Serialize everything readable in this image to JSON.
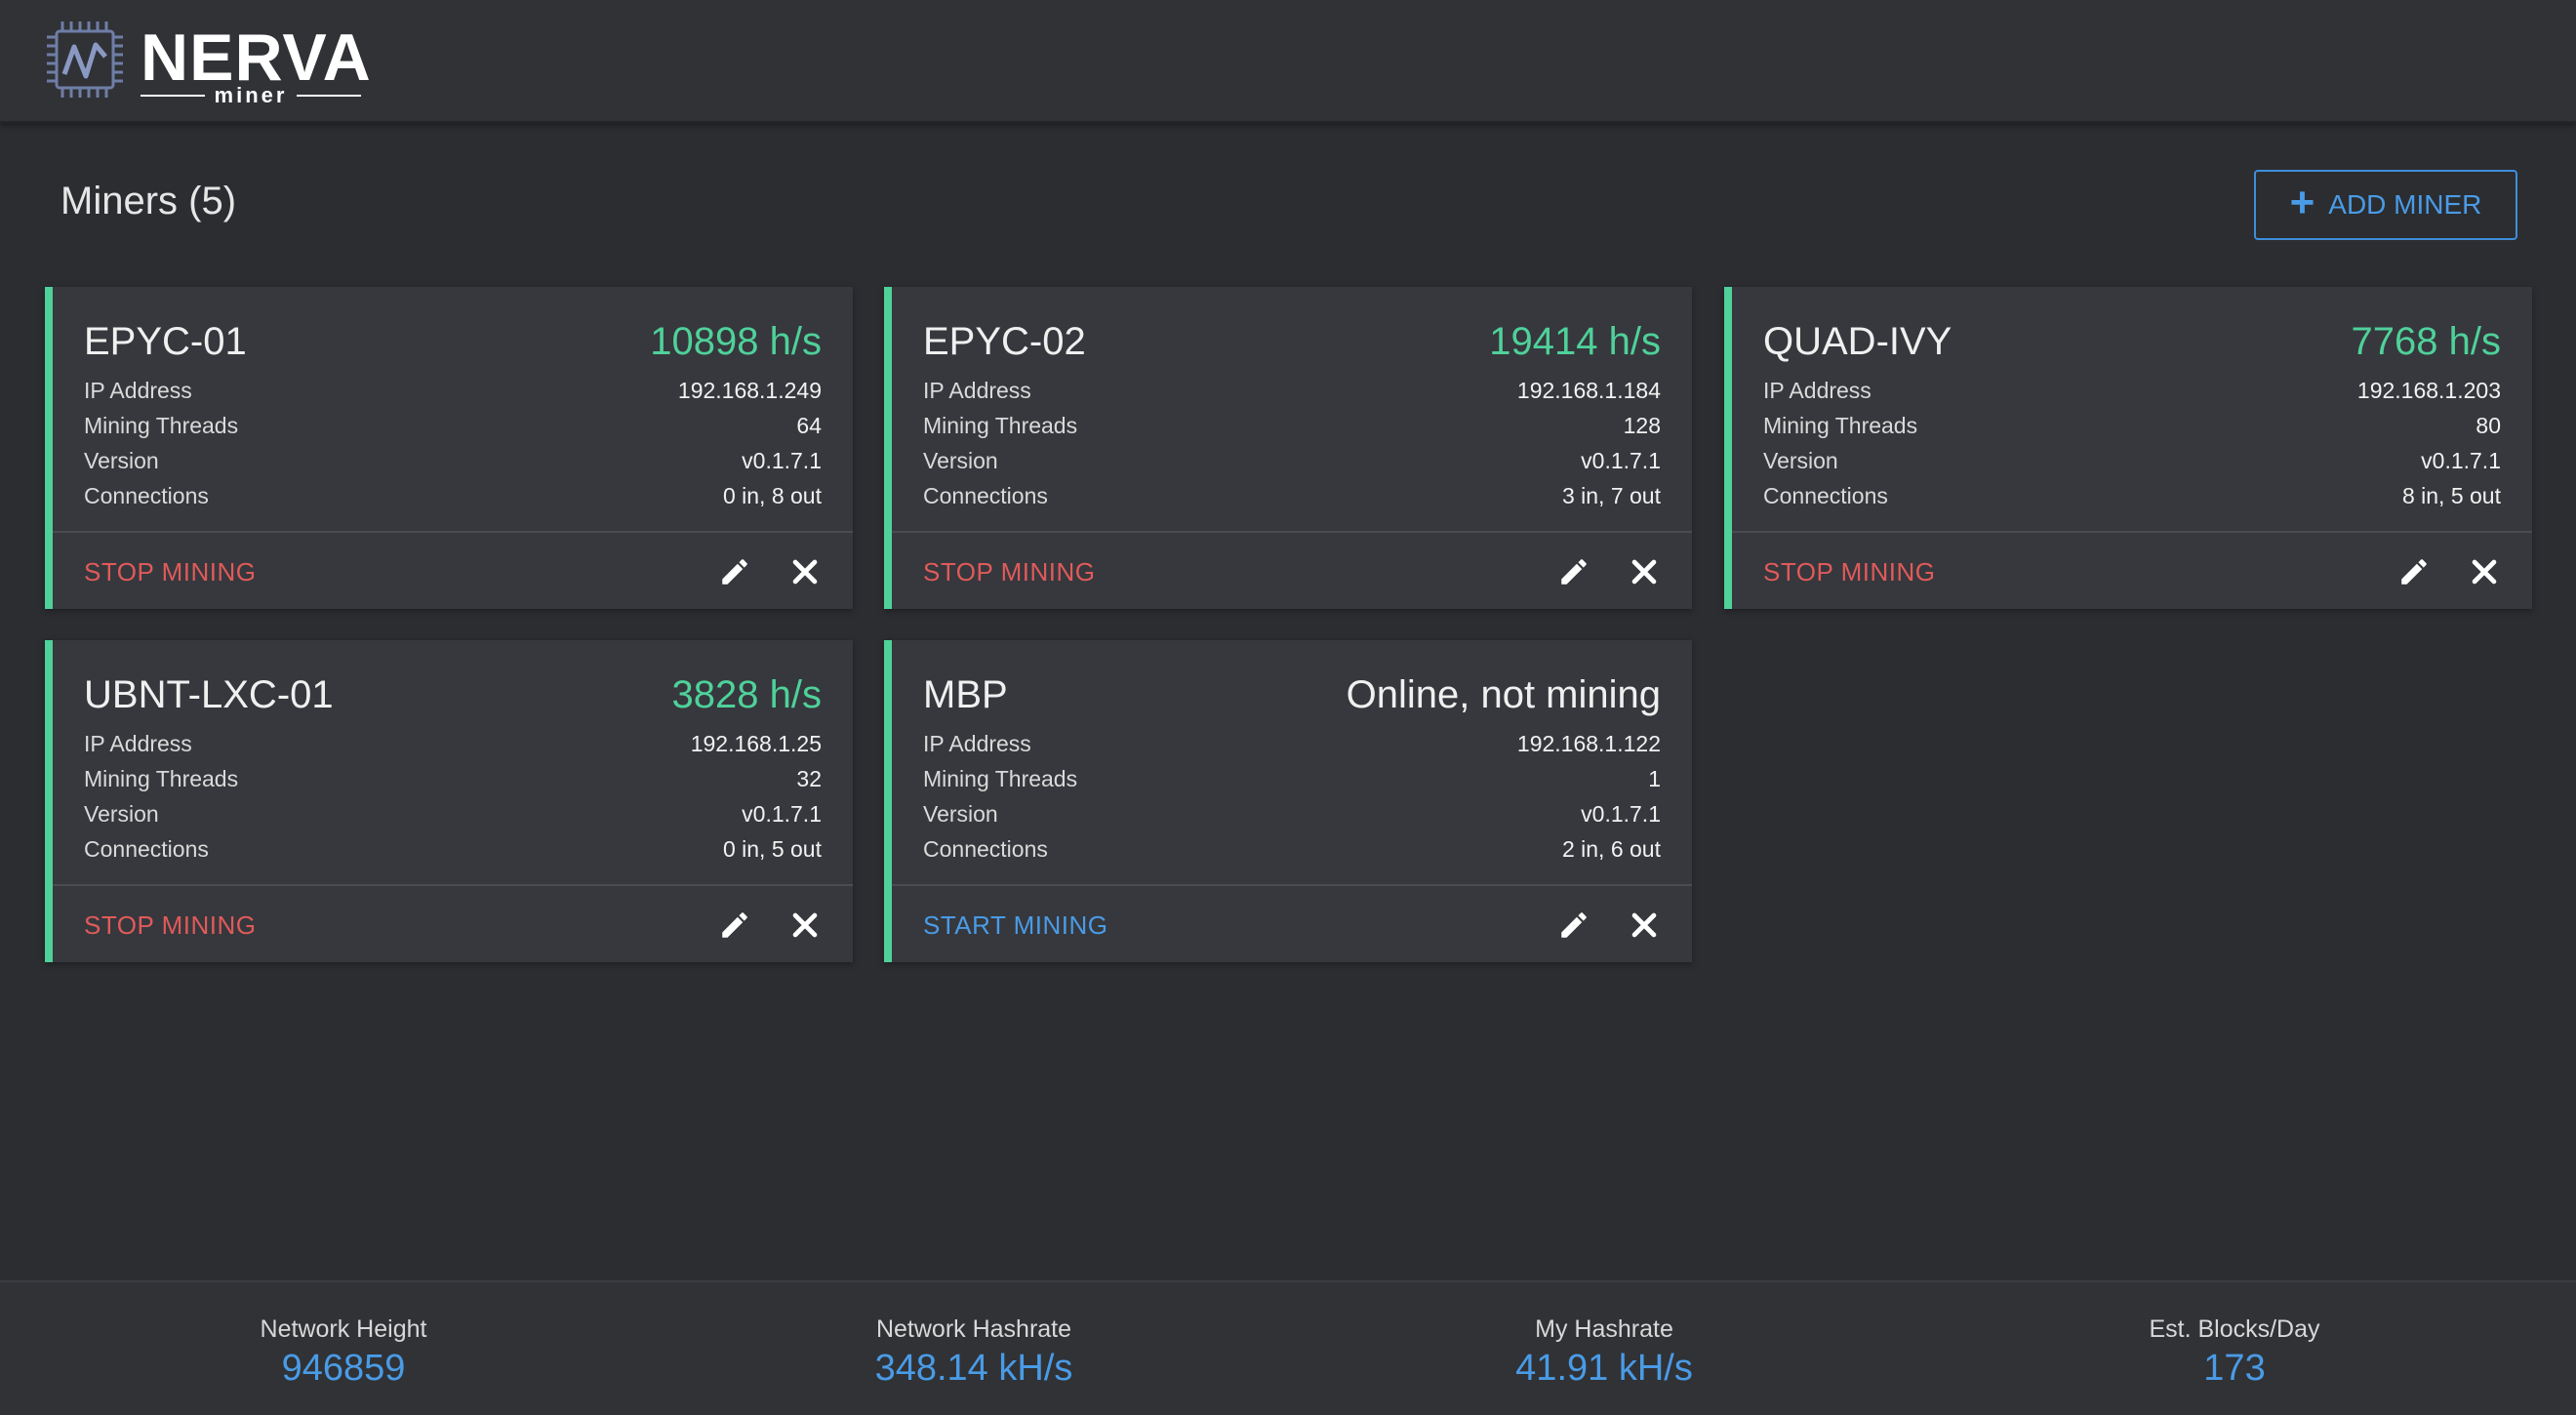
{
  "app": {
    "logo_word": "NERVA",
    "logo_sub": "miner"
  },
  "header": {
    "title": "Miners (5)",
    "add_button_label": "ADD MINER"
  },
  "miners": [
    {
      "name": "EPYC-01",
      "hashrate": "10898 h/s",
      "ip_label": "IP Address",
      "ip": "192.168.1.249",
      "threads_label": "Mining Threads",
      "threads": "64",
      "version_label": "Version",
      "version": "v0.1.7.1",
      "conn_label": "Connections",
      "connections": "0 in, 8 out",
      "action": "STOP MINING"
    },
    {
      "name": "EPYC-02",
      "hashrate": "19414 h/s",
      "ip_label": "IP Address",
      "ip": "192.168.1.184",
      "threads_label": "Mining Threads",
      "threads": "128",
      "version_label": "Version",
      "version": "v0.1.7.1",
      "conn_label": "Connections",
      "connections": "3 in, 7 out",
      "action": "STOP MINING"
    },
    {
      "name": "QUAD-IVY",
      "hashrate": "7768 h/s",
      "ip_label": "IP Address",
      "ip": "192.168.1.203",
      "threads_label": "Mining Threads",
      "threads": "80",
      "version_label": "Version",
      "version": "v0.1.7.1",
      "conn_label": "Connections",
      "connections": "8 in, 5 out",
      "action": "STOP MINING"
    },
    {
      "name": "UBNT-LXC-01",
      "hashrate": "3828 h/s",
      "ip_label": "IP Address",
      "ip": "192.168.1.25",
      "threads_label": "Mining Threads",
      "threads": "32",
      "version_label": "Version",
      "version": "v0.1.7.1",
      "conn_label": "Connections",
      "connections": "0 in, 5 out",
      "action": "STOP MINING"
    },
    {
      "name": "MBP",
      "hashrate": "Online, not mining",
      "ip_label": "IP Address",
      "ip": "192.168.1.122",
      "threads_label": "Mining Threads",
      "threads": "1",
      "version_label": "Version",
      "version": "v0.1.7.1",
      "conn_label": "Connections",
      "connections": "2 in, 6 out",
      "action": "START MINING"
    }
  ],
  "footer": {
    "network_height_label": "Network Height",
    "network_height": "946859",
    "network_hashrate_label": "Network Hashrate",
    "network_hashrate": "348.14 kH/s",
    "my_hashrate_label": "My Hashrate",
    "my_hashrate": "41.91 kH/s",
    "blocks_label": "Est. Blocks/Day",
    "blocks": "173"
  },
  "colors": {
    "background": "#2b2d31",
    "card": "#36383d",
    "accent_green": "#4fd19a",
    "accent_blue": "#4a9be6",
    "stop_red": "#e05a5a"
  },
  "icons": {
    "logo": "chip-icon",
    "edit": "pencil-icon",
    "delete": "close-icon",
    "add": "plus-icon"
  }
}
